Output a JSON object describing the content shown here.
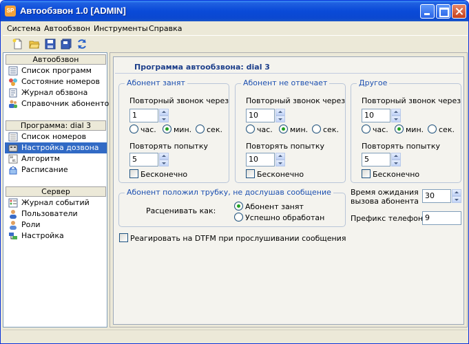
{
  "window": {
    "app_icon_text": "SP",
    "title": "Автообзвон 1.0 [ADMIN]",
    "colors": {
      "titlebar": "#0a4ad8",
      "selection": "#316ac5",
      "accent_text": "#1b4fb0"
    }
  },
  "menu": {
    "items": [
      {
        "label": "Система"
      },
      {
        "label": "Автообзвон"
      },
      {
        "label": "Инструменты"
      },
      {
        "label": "Справка"
      }
    ]
  },
  "toolbar": {
    "icons": [
      "new-document-icon",
      "open-folder-icon",
      "save-icon",
      "save-all-icon",
      "refresh-icon"
    ]
  },
  "sidebar": {
    "groups": [
      {
        "title": "Автообзвон",
        "items": [
          {
            "label": "Список программ",
            "icon": "list-icon"
          },
          {
            "label": "Состояние номеров",
            "icon": "status-icon"
          },
          {
            "label": "Журнал обзвона",
            "icon": "journal-icon"
          },
          {
            "label": "Справочник абонентов",
            "icon": "contacts-icon"
          }
        ]
      },
      {
        "title": "Программа: dial 3",
        "items": [
          {
            "label": "Список номеров",
            "icon": "phone-list-icon"
          },
          {
            "label": "Настройка дозвона",
            "icon": "settings-icon",
            "selected": true
          },
          {
            "label": "Алгоритм",
            "icon": "algorithm-icon"
          },
          {
            "label": "Расписание",
            "icon": "schedule-icon"
          }
        ]
      },
      {
        "title": "Сервер",
        "items": [
          {
            "label": "Журнал событий",
            "icon": "events-icon"
          },
          {
            "label": "Пользователи",
            "icon": "users-icon"
          },
          {
            "label": "Роли",
            "icon": "roles-icon"
          },
          {
            "label": "Настройка",
            "icon": "server-settings-icon"
          }
        ]
      }
    ]
  },
  "main": {
    "title": "Программа автообзвона: dial 3",
    "groups": [
      {
        "legend": "Абонент занят",
        "repeat_call_label": "Повторный звонок через",
        "repeat_call_value": "1",
        "units": [
          "час.",
          "мин.",
          "сек."
        ],
        "unit_selected": "мин.",
        "retry_label": "Повторять попытку",
        "retry_value": "5",
        "infinite_label": "Бесконечно",
        "infinite_checked": false
      },
      {
        "legend": "Абонент не отвечает",
        "repeat_call_label": "Повторный звонок через",
        "repeat_call_value": "10",
        "units": [
          "час.",
          "мин.",
          "сек."
        ],
        "unit_selected": "мин.",
        "retry_label": "Повторять попытку",
        "retry_value": "10",
        "infinite_label": "Бесконечно",
        "infinite_checked": false
      },
      {
        "legend": "Другое",
        "repeat_call_label": "Повторный звонок через",
        "repeat_call_value": "10",
        "units": [
          "час.",
          "мин.",
          "сек."
        ],
        "unit_selected": "мин.",
        "retry_label": "Повторять попытку",
        "retry_value": "5",
        "infinite_label": "Бесконечно",
        "infinite_checked": false
      }
    ],
    "hangup": {
      "legend": "Абонент положил трубку, не дослушав сообщение",
      "treat_as_label": "Расценивать как:",
      "options": [
        "Абонент занят",
        "Успешно обработан"
      ],
      "selected": "Абонент занят"
    },
    "wait_time_label_line1": "Время ожидания",
    "wait_time_label_line2": "вызова абонента",
    "wait_time_value": "30",
    "prefix_label": "Префикс телефона",
    "prefix_value": "9",
    "dtmf_label": "Реагировать на DTFM при прослушивании сообщения",
    "dtmf_checked": false
  }
}
